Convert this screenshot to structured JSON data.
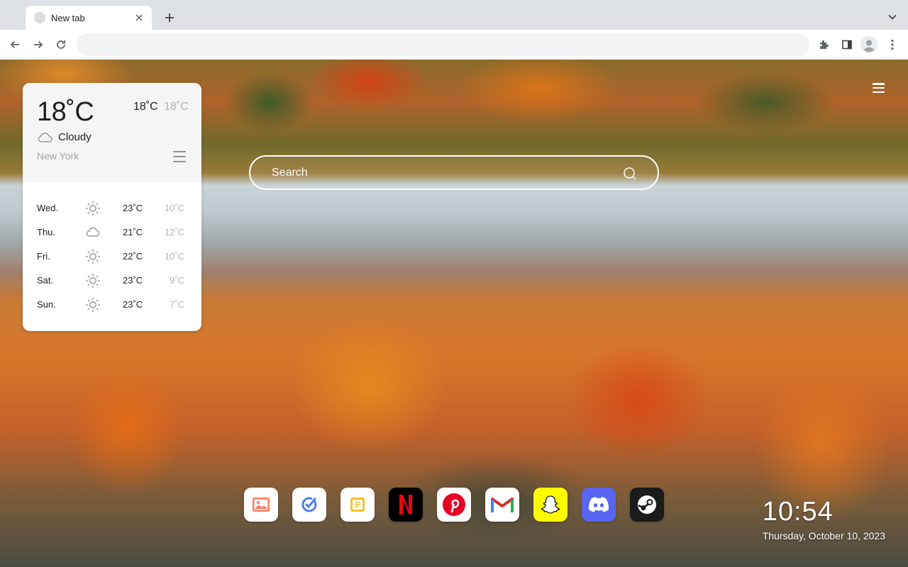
{
  "browser": {
    "tab_title": "New tab",
    "address_value": "",
    "icons": [
      "tab-favicon",
      "close-icon",
      "plus-icon",
      "chevron-down-icon",
      "arrow-left-icon",
      "arrow-right-icon",
      "reload-icon",
      "puzzle-icon",
      "side-panel-icon",
      "profile-icon",
      "more-vert-icon"
    ]
  },
  "weather": {
    "current_temp": "18˚C",
    "high": "18˚C",
    "low": "18˚C",
    "condition": "Cloudy",
    "condition_icon": "cloud-icon",
    "city": "New York",
    "forecast": [
      {
        "day": "Wed.",
        "icon": "sun-icon",
        "high": "23˚C",
        "low": "10˚C"
      },
      {
        "day": "Thu.",
        "icon": "cloud-icon",
        "high": "21˚C",
        "low": "12˚C"
      },
      {
        "day": "Fri.",
        "icon": "sun-icon",
        "high": "22˚C",
        "low": "10˚C"
      },
      {
        "day": "Sat.",
        "icon": "sun-icon",
        "high": "23˚C",
        "low": "9˚C"
      },
      {
        "day": "Sun.",
        "icon": "sun-icon",
        "high": "23˚C",
        "low": "7˚C"
      }
    ]
  },
  "search": {
    "placeholder": "Search",
    "icon": "search-icon"
  },
  "dock": {
    "apps": [
      {
        "name": "photos",
        "icon": "photos-icon",
        "color": "#ffffff"
      },
      {
        "name": "tasks",
        "icon": "check-icon",
        "color": "#ffffff"
      },
      {
        "name": "notes",
        "icon": "notes-icon",
        "color": "#ffffff"
      },
      {
        "name": "netflix",
        "icon": "netflix-icon",
        "color": "#000000"
      },
      {
        "name": "pinterest",
        "icon": "pinterest-icon",
        "color": "#ffffff"
      },
      {
        "name": "gmail",
        "icon": "gmail-icon",
        "color": "#ffffff"
      },
      {
        "name": "snapchat",
        "icon": "snapchat-icon",
        "color": "#fffc00"
      },
      {
        "name": "discord",
        "icon": "discord-icon",
        "color": "#5865f2"
      },
      {
        "name": "steam",
        "icon": "steam-icon",
        "color": "#1b1b1b"
      }
    ]
  },
  "clock": {
    "time": "10:54",
    "date": "Thursday, October 10, 2023"
  },
  "colors": {
    "tabstrip": "#dee1e6",
    "omnibox": "#f1f3f4",
    "netflix_red": "#e50914",
    "pinterest_red": "#e60023",
    "discord": "#5865f2",
    "snapchat": "#fffc00"
  }
}
